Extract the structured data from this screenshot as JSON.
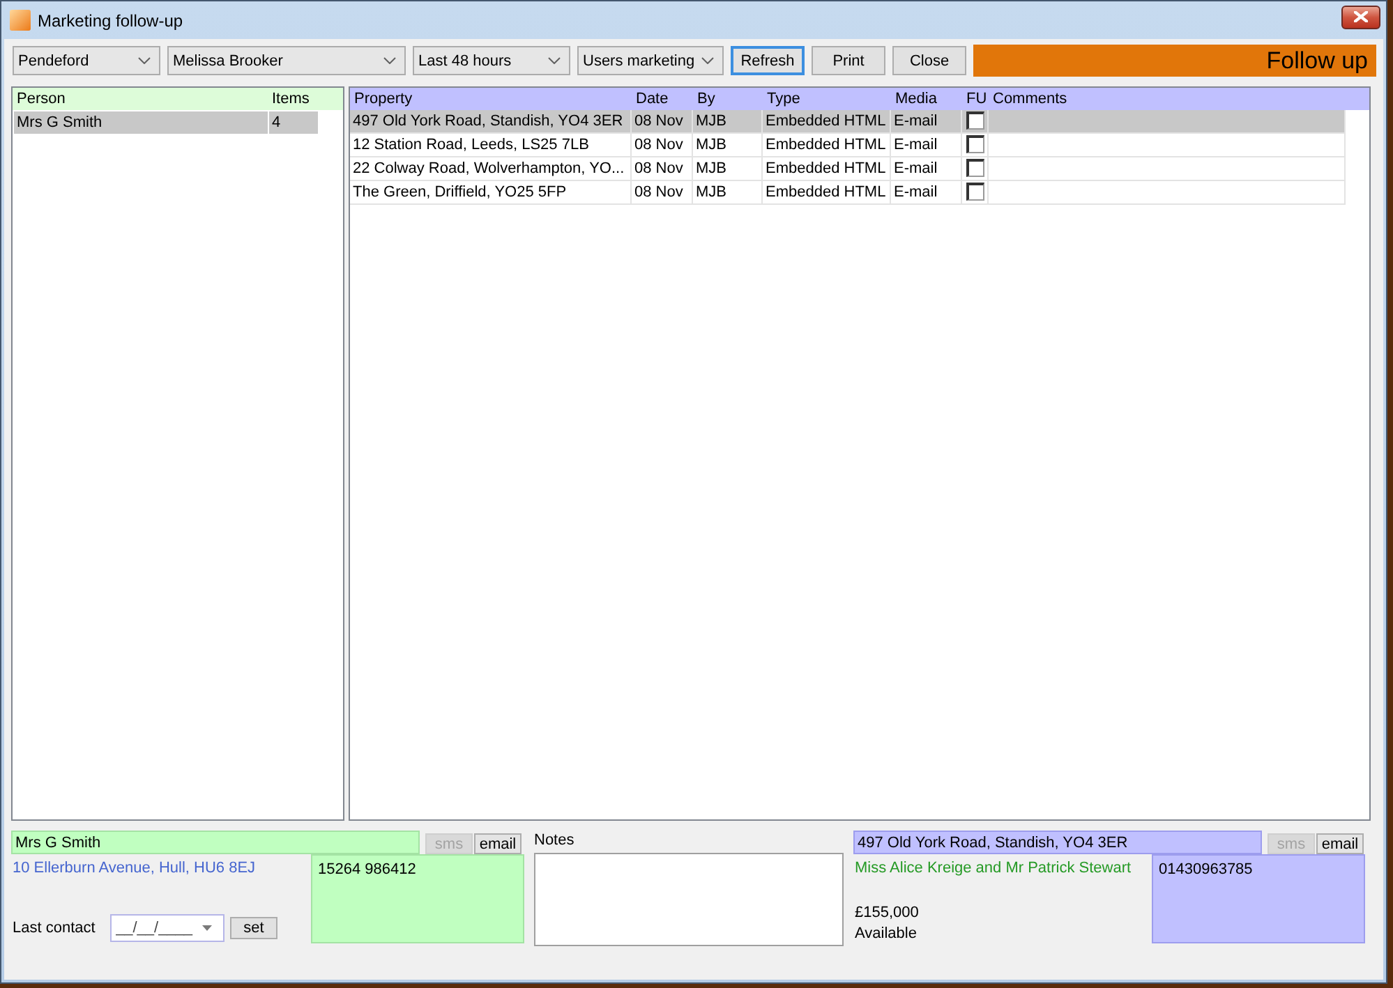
{
  "window": {
    "title": "Marketing follow-up"
  },
  "toolbar": {
    "dropdowns": [
      {
        "value": "Pendeford"
      },
      {
        "value": "Melissa Brooker"
      },
      {
        "value": "Last 48 hours"
      },
      {
        "value": "Users marketing"
      }
    ],
    "buttons": [
      {
        "label": "Refresh",
        "focused": true
      },
      {
        "label": "Print",
        "focused": false
      },
      {
        "label": "Close",
        "focused": false
      }
    ],
    "banner": "Follow up"
  },
  "people": {
    "columns": [
      "Person",
      "Items"
    ],
    "rows": [
      {
        "person": "Mrs G Smith",
        "items": "4",
        "selected": true
      }
    ]
  },
  "properties": {
    "columns": [
      "Property",
      "Date",
      "By",
      "Type",
      "Media",
      "FU",
      "Comments"
    ],
    "rows": [
      {
        "property": "497 Old York Road, Standish, YO4 3ER",
        "date": "08 Nov",
        "by": "MJB",
        "type": "Embedded HTML",
        "media": "E-mail",
        "fu": false,
        "selected": true
      },
      {
        "property": "12 Station Road, Leeds, LS25 7LB",
        "date": "08 Nov",
        "by": "MJB",
        "type": "Embedded HTML",
        "media": "E-mail",
        "fu": false,
        "selected": false
      },
      {
        "property": "22 Colway Road, Wolverhampton, YO...",
        "date": "08 Nov",
        "by": "MJB",
        "type": "Embedded HTML",
        "media": "E-mail",
        "fu": false,
        "selected": false
      },
      {
        "property": "The Green, Driffield, YO25 5FP",
        "date": "08 Nov",
        "by": "MJB",
        "type": "Embedded HTML",
        "media": "E-mail",
        "fu": false,
        "selected": false
      }
    ]
  },
  "contact": {
    "name": "Mrs G Smith",
    "sms": {
      "label": "sms",
      "disabled": true
    },
    "email": {
      "label": "email",
      "disabled": false
    },
    "address": "10 Ellerburn Avenue, Hull, HU6 8EJ",
    "phone": "15264 986412",
    "last_contact": {
      "label": "Last contact",
      "placeholder": "__/__/____",
      "button": "set"
    }
  },
  "notes": {
    "label": "Notes"
  },
  "property": {
    "address": "497 Old York Road, Standish, YO4 3ER",
    "sms": {
      "label": "sms",
      "disabled": true
    },
    "email": {
      "label": "email",
      "disabled": false
    },
    "owners": "Miss Alice Kreige and Mr Patrick Stewart",
    "phone": "01430963785",
    "price": "£155,000",
    "status": "Available"
  }
}
